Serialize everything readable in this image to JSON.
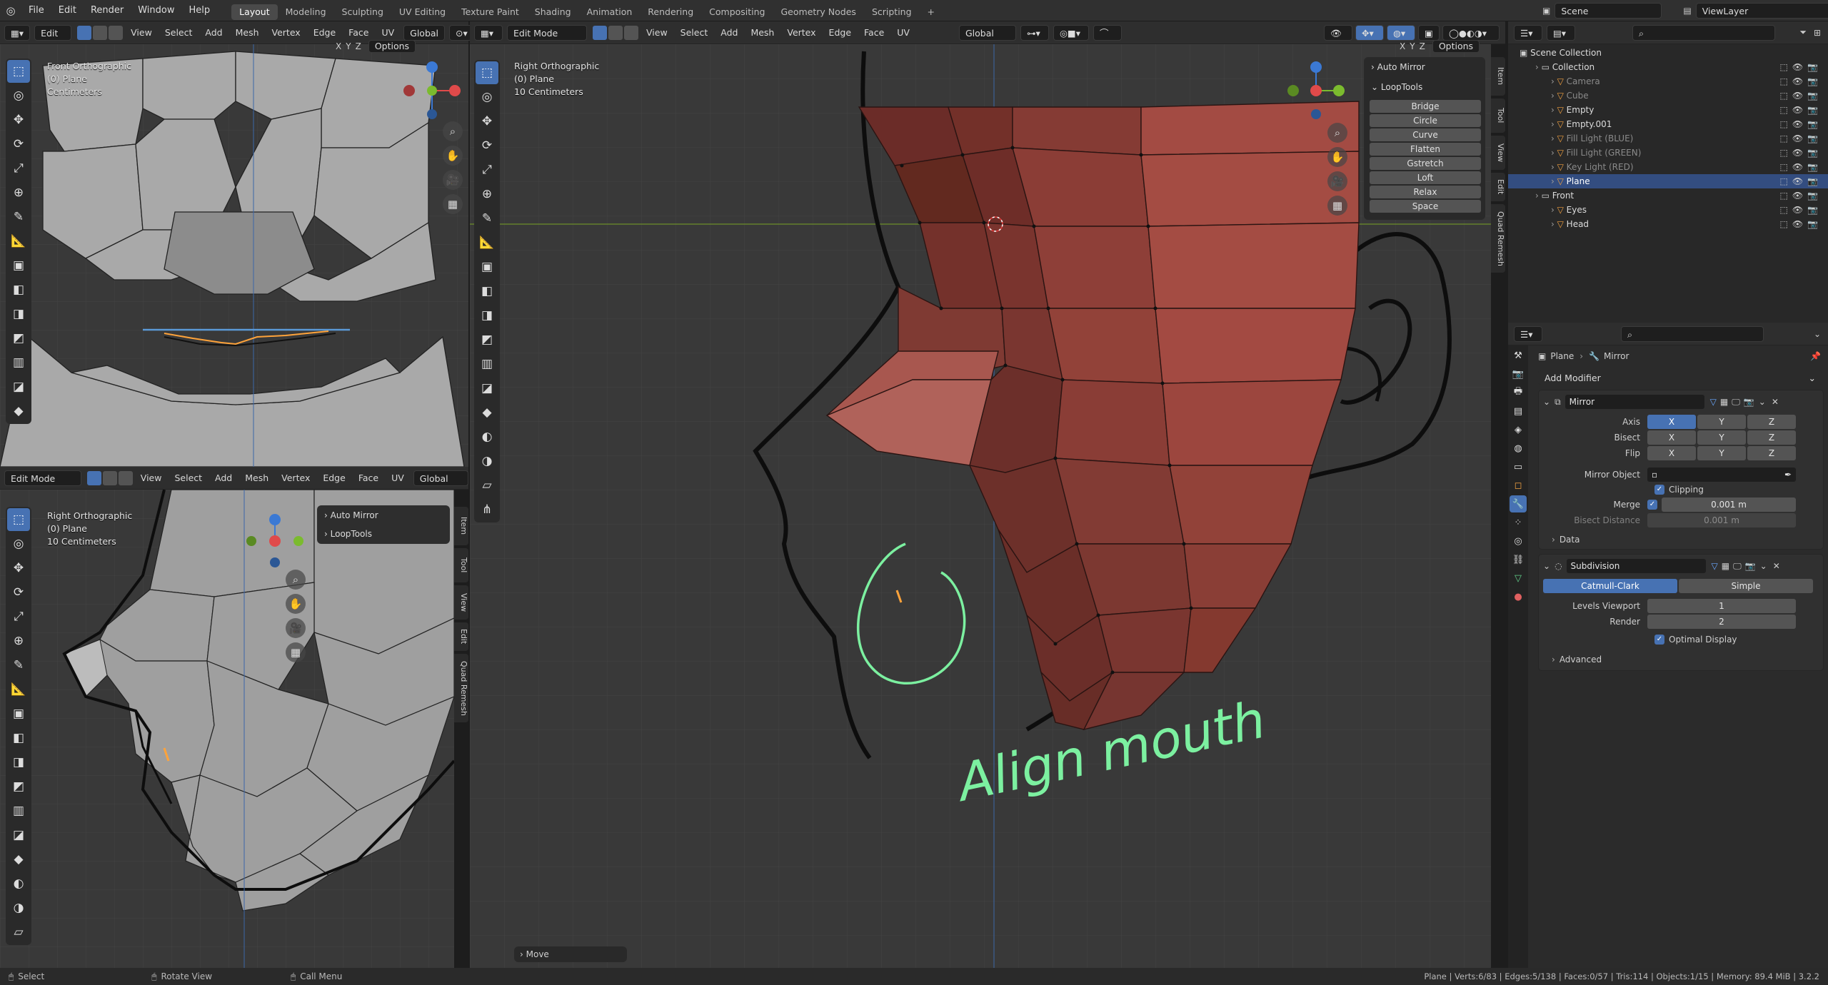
{
  "topbar": {
    "menus": [
      "File",
      "Edit",
      "Render",
      "Window",
      "Help"
    ],
    "workspaces": [
      "Layout",
      "Modeling",
      "Sculpting",
      "UV Editing",
      "Texture Paint",
      "Shading",
      "Animation",
      "Rendering",
      "Compositing",
      "Geometry Nodes",
      "Scripting"
    ],
    "active_workspace": "Layout",
    "add_tab": "+",
    "scene": "Scene",
    "view_layer": "ViewLayer"
  },
  "viewport_header": {
    "mode": "Edit Mode",
    "menus": [
      "View",
      "Select",
      "Add",
      "Mesh",
      "Vertex",
      "Edge",
      "Face",
      "UV"
    ],
    "transform_orientation": "Global",
    "axes": [
      "X",
      "Y",
      "Z"
    ],
    "options": "Options"
  },
  "vp_top_left": {
    "view_name": "Front Orthographic",
    "object": "(0) Plane",
    "scale": "Centimeters"
  },
  "vp_bottom_left": {
    "view_name": "Right Orthographic",
    "object": "(0) Plane",
    "scale": "10 Centimeters"
  },
  "vp_main": {
    "view_name": "Right Orthographic",
    "object": "(0) Plane",
    "scale": "10 Centimeters",
    "annotation": "Align mouth",
    "operator_panel": "Move"
  },
  "sidebar_panels": {
    "auto_mirror": "Auto Mirror",
    "looptools": "LoopTools",
    "looptools_ops": [
      "Bridge",
      "Circle",
      "Curve",
      "Flatten",
      "Gstretch",
      "Loft",
      "Relax",
      "Space"
    ],
    "tabs": [
      "Item",
      "Tool",
      "View",
      "Edit",
      "Quad Remesh"
    ]
  },
  "outliner": {
    "root": "Scene Collection",
    "items": [
      {
        "label": "Collection",
        "depth": 1,
        "dim": false,
        "selected": false
      },
      {
        "label": "Camera",
        "depth": 2,
        "dim": true,
        "selected": false
      },
      {
        "label": "Cube",
        "depth": 2,
        "dim": true,
        "selected": false
      },
      {
        "label": "Empty",
        "depth": 2,
        "dim": false,
        "selected": false
      },
      {
        "label": "Empty.001",
        "depth": 2,
        "dim": false,
        "selected": false
      },
      {
        "label": "Fill Light (BLUE)",
        "depth": 2,
        "dim": true,
        "selected": false
      },
      {
        "label": "Fill Light (GREEN)",
        "depth": 2,
        "dim": true,
        "selected": false
      },
      {
        "label": "Key Light (RED)",
        "depth": 2,
        "dim": true,
        "selected": false
      },
      {
        "label": "Plane",
        "depth": 2,
        "dim": false,
        "selected": true
      },
      {
        "label": "Front",
        "depth": 1,
        "dim": false,
        "selected": false
      },
      {
        "label": "Eyes",
        "depth": 2,
        "dim": false,
        "selected": false
      },
      {
        "label": "Head",
        "depth": 2,
        "dim": false,
        "selected": false
      }
    ]
  },
  "properties": {
    "breadcrumb_object": "Plane",
    "breadcrumb_modifier": "Mirror",
    "add_modifier": "Add Modifier",
    "mirror": {
      "name": "Mirror",
      "axis_label": "Axis",
      "bisect_label": "Bisect",
      "flip_label": "Flip",
      "mirror_object_label": "Mirror Object",
      "clipping_label": "Clipping",
      "merge_label": "Merge",
      "merge_value": "0.001 m",
      "bisect_distance_label": "Bisect Distance",
      "bisect_distance_value": "0.001 m",
      "data_label": "Data"
    },
    "subdivision": {
      "name": "Subdivision",
      "type_a": "Catmull-Clark",
      "type_b": "Simple",
      "levels_viewport_label": "Levels Viewport",
      "levels_viewport": "1",
      "render_label": "Render",
      "render": "2",
      "optimal_display_label": "Optimal Display",
      "advanced_label": "Advanced"
    }
  },
  "statusbar": {
    "select": "Select",
    "rotate": "Rotate View",
    "call_menu": "Call Menu",
    "stats": "Plane | Verts:6/83 | Edges:5/138 | Faces:0/57 | Tris:114 | Objects:1/15 | Memory: 89.4 MiB | 3.2.2"
  },
  "colors": {
    "accent": "#4772b3",
    "mesh_face": "#9c4a43",
    "annotation": "#7cf0a0",
    "selected_edge": "#ff9a2a"
  }
}
